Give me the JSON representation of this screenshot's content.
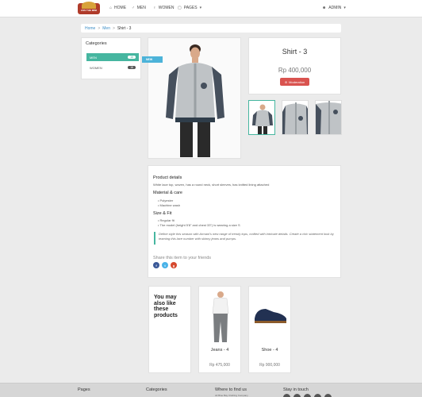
{
  "header": {
    "logo_text": "ASS THE MINI",
    "nav": [
      {
        "label": "HOME",
        "icon": "home-icon"
      },
      {
        "label": "MEN",
        "icon": "male-icon"
      },
      {
        "label": "WOMEN",
        "icon": "female-icon"
      },
      {
        "label": "PAGES",
        "icon": "pages-icon"
      }
    ],
    "user_label": "ADMIN"
  },
  "breadcrumb": [
    "Home",
    "Men",
    "Shirt - 3"
  ],
  "sidebar": {
    "title": "Categories",
    "items": [
      {
        "label": "MEN",
        "count": "16",
        "active": true
      },
      {
        "label": "WOMEN",
        "count": "16",
        "active": false
      }
    ]
  },
  "product": {
    "badge": "NEW",
    "title": "Shirt - 3",
    "price": "Rp 400,000",
    "moderation_label": "Moderation"
  },
  "details": {
    "product_details_title": "Product details",
    "product_details_text": "White lace top, woven, has a round neck, short sleeves, has knitted lining attached",
    "material_title": "Material & care",
    "material_items": [
      "Polyester",
      "Machine wash"
    ],
    "size_title": "Size & Fit",
    "size_items": [
      "Regular fit",
      "The model (height 5'8\" and chest 33\") is wearing a size S"
    ],
    "quote": "Define style this season with Armani's new range of trendy tops, crafted with intricate details. Create a chic statement look by teaming this lace number with skinny jeans and pumps.",
    "share_title": "Share this item to your friends"
  },
  "related": {
    "title": "You may also like these products",
    "items": [
      {
        "name": "Jeans - 4",
        "price": "Rp 475,000"
      },
      {
        "name": "Shoe - 4",
        "price": "Rp 900,000"
      }
    ]
  },
  "footer": {
    "columns": [
      "Pages",
      "Categories",
      "Where to find us",
      "Stay in touch"
    ],
    "address_line": "Ali Blue Bay Clothing Company"
  },
  "colors": {
    "accent": "#46b6a0",
    "danger": "#d9534f",
    "badge": "#4cb3d9"
  }
}
